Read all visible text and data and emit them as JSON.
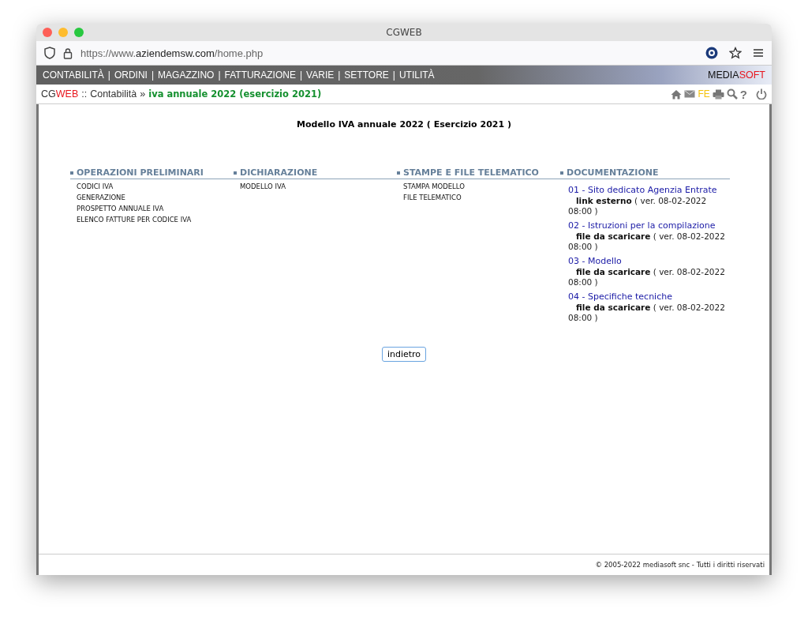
{
  "window": {
    "title": "CGWEB"
  },
  "address_bar": {
    "url_parts": [
      {
        "text": "https://www.",
        "strong": false
      },
      {
        "text": "aziendemsw.com",
        "strong": true
      },
      {
        "text": "/home.php",
        "strong": false
      }
    ]
  },
  "menu": {
    "items": [
      {
        "label": "CONTABILITÀ"
      },
      {
        "label": "ORDINI"
      },
      {
        "label": "MAGAZZINO"
      },
      {
        "label": "FATTURAZIONE"
      },
      {
        "label": "VARIE"
      },
      {
        "label": "SETTORE"
      },
      {
        "label": "UTILITÀ"
      }
    ],
    "separator": "|",
    "brand": [
      {
        "text": "MEDIA",
        "accent": false
      },
      {
        "text": "SOFT",
        "accent": true
      }
    ]
  },
  "breadcrumb": {
    "logo": [
      {
        "text": "CG",
        "accent": false
      },
      {
        "text": "WEB",
        "accent": true
      }
    ],
    "separator": "::",
    "section": "Contabilità",
    "arrow": "»",
    "current": "iva annuale 2022 (esercizio 2021)"
  },
  "toolbar": {
    "fe_label": "FE",
    "help_label": "?"
  },
  "page_title": "Modello IVA annuale 2022 ( Esercizio 2021 )",
  "columns": [
    {
      "heading": "OPERAZIONI PRELIMINARI",
      "kind": "menu",
      "items": [
        {
          "label": "CODICI IVA"
        },
        {
          "label": "GENERAZIONE"
        },
        {
          "label": "PROSPETTO ANNUALE IVA"
        },
        {
          "label": "ELENCO FATTURE PER CODICE IVA"
        }
      ]
    },
    {
      "heading": "DICHIARAZIONE",
      "kind": "menu",
      "items": [
        {
          "label": "MODELLO IVA"
        }
      ]
    },
    {
      "heading": "STAMPE E FILE TELEMATICO",
      "kind": "menu",
      "items": [
        {
          "label": "STAMPA MODELLO"
        },
        {
          "label": "FILE TELEMATICO"
        }
      ]
    },
    {
      "heading": "DOCUMENTAZIONE",
      "kind": "docs",
      "items": [
        {
          "label": "01 - Sito dedicato Agenzia Entrate",
          "note": "**link esterno** ( ver. 08-02-2022 08:00 )"
        },
        {
          "label": "02 - Istruzioni per la compilazione",
          "note": "**file da scaricare** ( ver. 08-02-2022 08:00 )"
        },
        {
          "label": "03 - Modello",
          "note": "**file da scaricare** ( ver. 08-02-2022 08:00 )"
        },
        {
          "label": "04 - Specifiche tecniche",
          "note": "**file da scaricare** ( ver. 08-02-2022 08:00 )"
        }
      ]
    }
  ],
  "back_button": "indietro",
  "footer": "© 2005-2022 mediasoft snc - Tutti i diritti riservati"
}
